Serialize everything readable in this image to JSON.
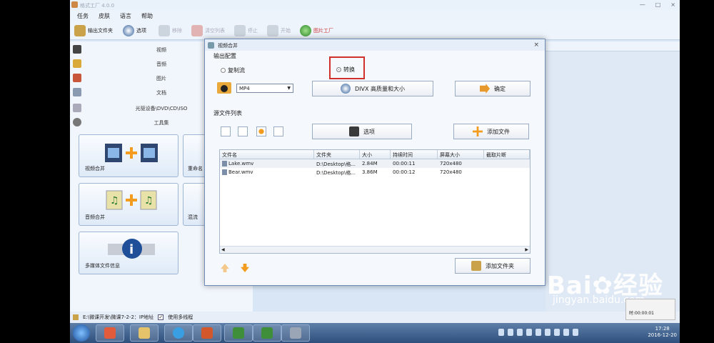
{
  "app": {
    "title": "格式工厂 4.0.0",
    "menu": [
      "任务",
      "皮肤",
      "语言",
      "帮助"
    ],
    "toolbar": {
      "output_folder": "输出文件夹",
      "options": "选项",
      "remove": "移除",
      "clear_list": "清空列表",
      "stop": "停止",
      "start": "开始",
      "picture_factory": "图片工厂"
    },
    "categories": [
      "视频",
      "音频",
      "图片",
      "文档",
      "光驱设备\\DVD\\CD\\ISO",
      "工具集"
    ],
    "tiles": {
      "video_merge": "视频合并",
      "audio_merge": "音频合并",
      "media_info": "多媒体文件信息",
      "rename": "重命名",
      "mix": "混流"
    },
    "statusbar": {
      "path": "E:\\微课开发\\微课7-2-2：IP地址",
      "multithread": "使用多线程"
    }
  },
  "dialog": {
    "title": "视频合并",
    "output_config": "输出配置",
    "radio_copy_stream": "复制流",
    "radio_convert": "转换",
    "format_select": "MP4",
    "quality_button": "DIVX 高质量和大小",
    "ok_button": "确定",
    "source_list_label": "源文件列表",
    "options_button": "选项",
    "add_file_button": "添加文件",
    "add_folder_button": "添加文件夹",
    "columns": [
      "文件名",
      "文件夹",
      "大小",
      "持续时间",
      "屏幕大小",
      "截取片断"
    ],
    "rows": [
      [
        "Lake.wmv",
        "D:\\Desktop\\格...",
        "2.84M",
        "00:00:11",
        "720x480",
        ""
      ],
      [
        "Bear.wmv",
        "D:\\Desktop\\格...",
        "3.86M",
        "00:00:12",
        "720x480",
        ""
      ]
    ]
  },
  "taskbar": {
    "time": "17:28",
    "date": "2016-12-20",
    "popup_time": "时:00:00:01"
  },
  "watermark": {
    "brand": "Bai",
    "brand_tail": "经验",
    "url": "jingyan.baidu.com"
  }
}
